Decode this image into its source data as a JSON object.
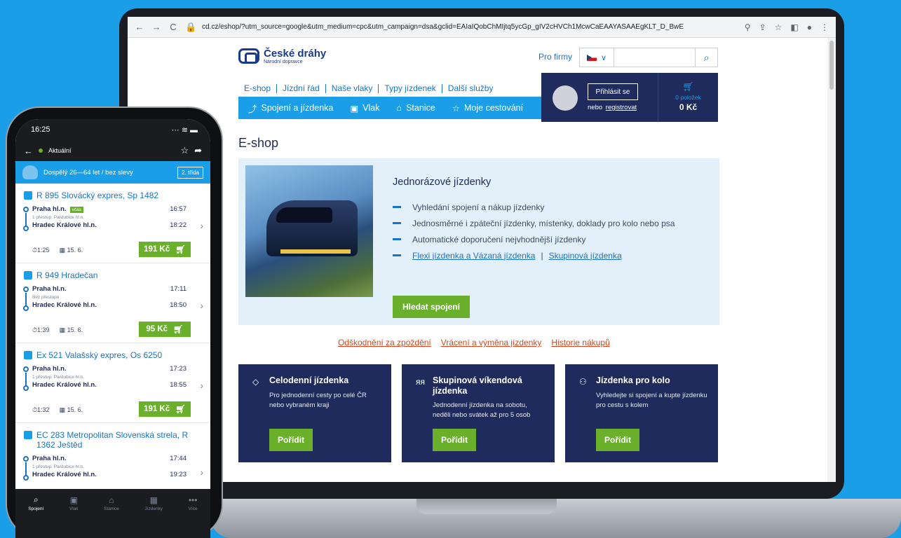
{
  "browser": {
    "url_domain": "cd.cz",
    "url_path": "/eshop/?utm_source=google&utm_medium=cpc&utm_campaign=dsa&gclid=EAIaIQobChMIjtq5ycGp_gIV2cHVCh1McwCaEAAYASAAEgKLT_D_BwE"
  },
  "site": {
    "logo_title": "České dráhy",
    "logo_sub": "Národní dopravce",
    "pro_firmy": "Pro firmy",
    "top_nav": [
      "E-shop",
      "Jízdní řád",
      "Naše vlaky",
      "Typy jízdenek",
      "Další služby"
    ],
    "sub_nav": [
      {
        "icon": "route-icon",
        "label": "Spojení a jízdenka"
      },
      {
        "icon": "train-icon",
        "label": "Vlak"
      },
      {
        "icon": "station-icon",
        "label": "Stanice"
      },
      {
        "icon": "star-icon",
        "label": "Moje cestování"
      }
    ],
    "login": "Přihlásit se",
    "register_prefix": "nebo",
    "register_link": "registrovat",
    "cart_count": "0 položek",
    "cart_sum": "0 Kč",
    "page_title": "E-shop"
  },
  "hero": {
    "title": "Jednorázové jízdenky",
    "bullets": [
      "Vyhledání spojení a nákup jízdenky",
      "Jednosměrné i zpáteční jízdenky, místenky, doklady pro kolo nebo psa",
      "Automatické doporučení nejvhodnější jízdenky"
    ],
    "link1": "Flexi jízdenka a Vázaná jízdenka",
    "link_sep": "|",
    "link2": "Skupinová jízdenka",
    "button": "Hledat spojení"
  },
  "mid_links": [
    "Odškodnění za zpoždění",
    "Vrácení a výměna jízdenky",
    "Historie nákupů"
  ],
  "cards": [
    {
      "icon": "ticket-icon",
      "title": "Celodenní jízdenka",
      "desc": "Pro jednodenní cesty po celé ČR nebo vybraném kraji",
      "button": "Pořídit"
    },
    {
      "icon": "group-icon",
      "title": "Skupinová víkendová jízdenka",
      "desc": "Jednodenní jízdenka na sobotu, neděli nebo svátek až pro 5 osob",
      "button": "Pořídit"
    },
    {
      "icon": "bike-icon",
      "title": "Jízdenka pro kolo",
      "desc": "Vyhledejte si spojení a kupte jízdenku pro cestu s kolem",
      "button": "Pořídit"
    }
  ],
  "phone": {
    "time": "16:25",
    "status_label": "Aktuální",
    "passenger": "Dospělý 26—64 let / bez slevy",
    "class": "2. třída",
    "connections": [
      {
        "title": "R 895 Slovácký expres, Sp 1482",
        "from": "Praha hl.n.",
        "badge": "včas",
        "dep": "16:57",
        "transfer": "1 přestup: Pardubice hl.n.",
        "to": "Hradec Králové hl.n.",
        "arr": "18:22",
        "dur": "1:25",
        "date": "15. 6.",
        "price": "191 Kč"
      },
      {
        "title": "R 949 Hradečan",
        "from": "Praha hl.n.",
        "badge": "",
        "dep": "17:11",
        "transfer": "Bez přestupu",
        "to": "Hradec Králové hl.n.",
        "arr": "18:50",
        "dur": "1:39",
        "date": "15. 6.",
        "price": "95 Kč"
      },
      {
        "title": "Ex 521 Valašský expres, Os 6250",
        "from": "Praha hl.n.",
        "badge": "",
        "dep": "17:23",
        "transfer": "1 přestup: Pardubice hl.n.",
        "to": "Hradec Králové hl.n.",
        "arr": "18:55",
        "dur": "1:32",
        "date": "15. 6.",
        "price": "191 Kč"
      },
      {
        "title": "EC 283 Metropolitan Slovenská strela, R 1362 Ještěd",
        "from": "Praha hl.n.",
        "badge": "",
        "dep": "17:44",
        "transfer": "1 přestup: Pardubice hl.n.",
        "to": "Hradec Králové hl.n.",
        "arr": "19:23",
        "dur": "",
        "date": "",
        "price": ""
      }
    ],
    "tabs": [
      {
        "icon": "search-icon",
        "label": "Spojení"
      },
      {
        "icon": "train-icon",
        "label": "Vlak"
      },
      {
        "icon": "station-icon",
        "label": "Stanice"
      },
      {
        "icon": "ticket-icon",
        "label": "Jízdenky"
      },
      {
        "icon": "more-icon",
        "label": "Více"
      }
    ]
  }
}
